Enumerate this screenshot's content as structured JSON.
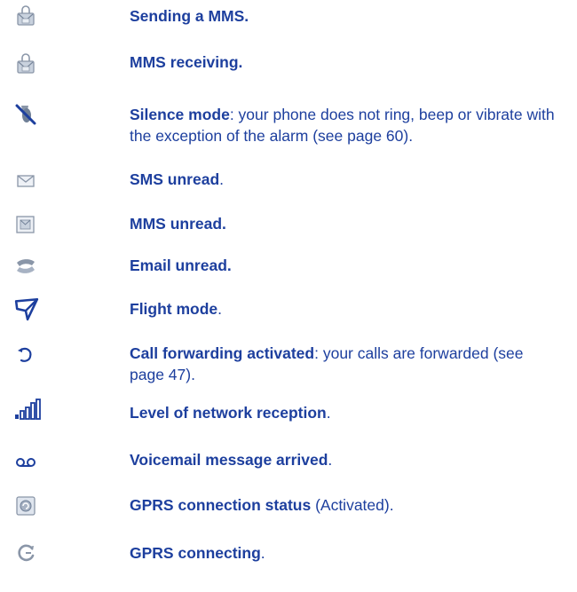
{
  "items": [
    {
      "icon": "mms-sending-icon",
      "title": "Sending a MMS.",
      "desc": ""
    },
    {
      "icon": "mms-receiving-icon",
      "title": "MMS receiving.",
      "desc": ""
    },
    {
      "icon": "silence-mode-icon",
      "title": "Silence mode",
      "desc": ": your phone does not ring, beep or vibrate with the exception of the alarm (see page 60)."
    },
    {
      "icon": "sms-unread-icon",
      "title": "SMS unread",
      "desc": "."
    },
    {
      "icon": "mms-unread-icon",
      "title": "MMS unread.",
      "desc": ""
    },
    {
      "icon": "email-unread-icon",
      "title": "Email unread.",
      "desc": ""
    },
    {
      "icon": "flight-mode-icon",
      "title": "Flight mode",
      "desc": "."
    },
    {
      "icon": "call-forwarding-icon",
      "title": "Call forwarding activated",
      "desc": ": your calls are forwarded (see page 47)."
    },
    {
      "icon": "network-level-icon",
      "title": "Level of network reception",
      "desc": "."
    },
    {
      "icon": "voicemail-icon",
      "title": "Voicemail message arrived",
      "desc": "."
    },
    {
      "icon": "gprs-status-icon",
      "title": "GPRS connection status",
      "desc": " (Activated)."
    },
    {
      "icon": "gprs-connecting-icon",
      "title": "GPRS connecting",
      "desc": "."
    }
  ],
  "colors": {
    "text": "#1d3f9e",
    "icon_gray": "#8a96a8",
    "icon_blue": "#1d3f9e"
  }
}
